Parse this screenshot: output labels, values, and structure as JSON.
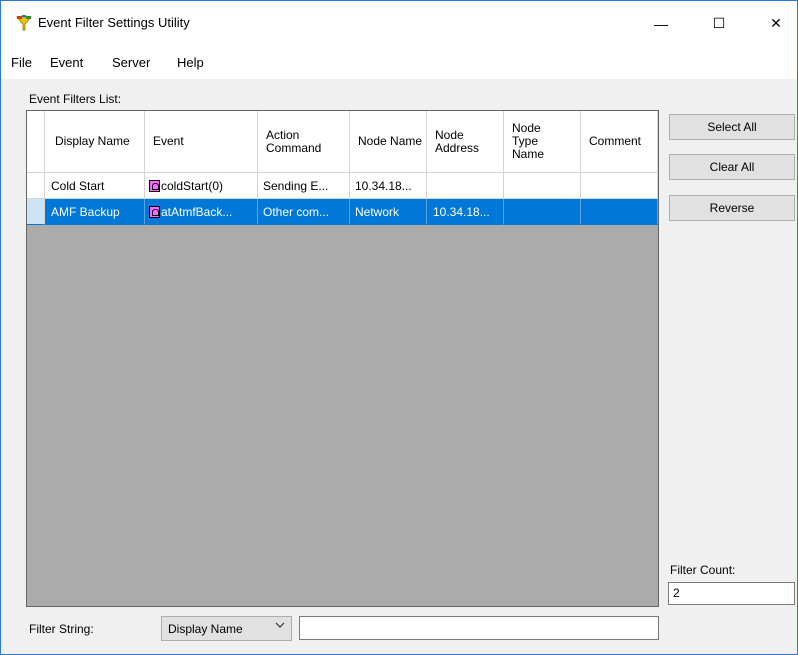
{
  "window": {
    "title": "Event Filter Settings Utility",
    "controls": {
      "minimize": "—",
      "maximize": "☐",
      "close": "✕"
    }
  },
  "menu": [
    "File",
    "Event",
    "Server",
    "Help"
  ],
  "list_label": "Event Filters List:",
  "columns": [
    "Display Name",
    "Event",
    "Action Command",
    "Node Name",
    "Node Address",
    "Node Type Name",
    "Comment"
  ],
  "rows": [
    {
      "display_name": "Cold Start",
      "event": "coldStart(0)",
      "action": "Sending E...",
      "node_name": "10.34.18...",
      "node_address": "",
      "node_type": "",
      "comment": "",
      "selected": false
    },
    {
      "display_name": "AMF Backup",
      "event": "atAtmfBack...",
      "action": "Other com...",
      "node_name": "Network",
      "node_address": "10.34.18...",
      "node_type": "",
      "comment": "",
      "selected": true
    }
  ],
  "buttons": {
    "select_all": "Select All",
    "clear_all": "Clear All",
    "reverse": "Reverse"
  },
  "filter_count": {
    "label": "Filter Count:",
    "value": "2"
  },
  "filter_string": {
    "label": "Filter String:",
    "selected": "Display Name",
    "value": ""
  },
  "colors": {
    "selection": "#0078d7",
    "grid_background": "#ababab",
    "event_icon": "#ff66ff"
  },
  "icons": {
    "app": "funnel-app-icon",
    "event": "bell-event-icon",
    "dropdown": "chevron-down-icon"
  }
}
